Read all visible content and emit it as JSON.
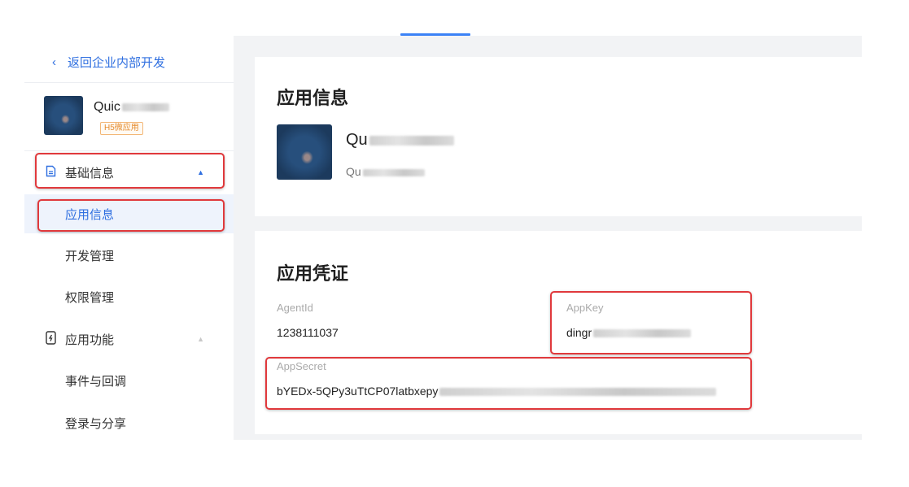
{
  "header": {
    "active_tab": ""
  },
  "sidebar": {
    "back_label": "返回企业内部开发",
    "app": {
      "name": "Quic",
      "tag": "H5微应用"
    },
    "basic_info": {
      "label": "基础信息"
    },
    "items": [
      {
        "label": "应用信息"
      },
      {
        "label": "开发管理"
      },
      {
        "label": "权限管理"
      }
    ],
    "app_features": {
      "label": "应用功能"
    },
    "sub_items": [
      {
        "label": "事件与回调"
      },
      {
        "label": "登录与分享"
      }
    ]
  },
  "app_info": {
    "title": "应用信息",
    "app_name": "Qu",
    "app_desc": "Qu"
  },
  "credentials": {
    "title": "应用凭证",
    "agent_id_label": "AgentId",
    "agent_id_value": "1238111037",
    "app_key_label": "AppKey",
    "app_key_value": "dingr",
    "app_secret_label": "AppSecret",
    "app_secret_value": "bYEDx-5QPy3uTtCP07latbxepy"
  },
  "colors": {
    "accent": "#2f6fe0",
    "highlight_box": "#e0393c",
    "tag": "#e58a2b"
  }
}
